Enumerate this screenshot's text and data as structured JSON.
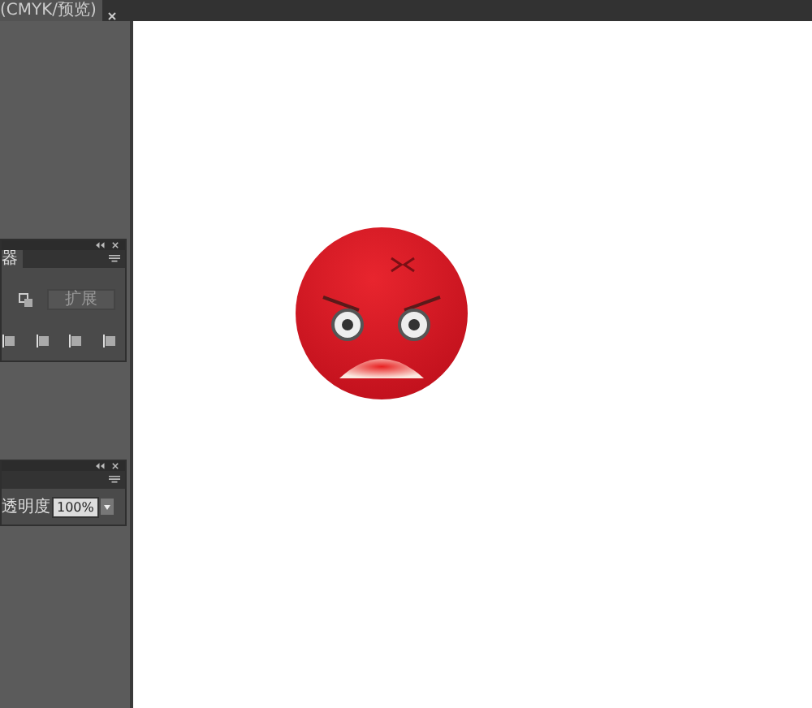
{
  "document_tab": {
    "title": "(CMYK/预览)"
  },
  "panels": [
    {
      "kind": "align",
      "tab": "器",
      "button": "扩展"
    },
    {
      "kind": "transparency",
      "label": "透明度",
      "value": "100%"
    }
  ]
}
